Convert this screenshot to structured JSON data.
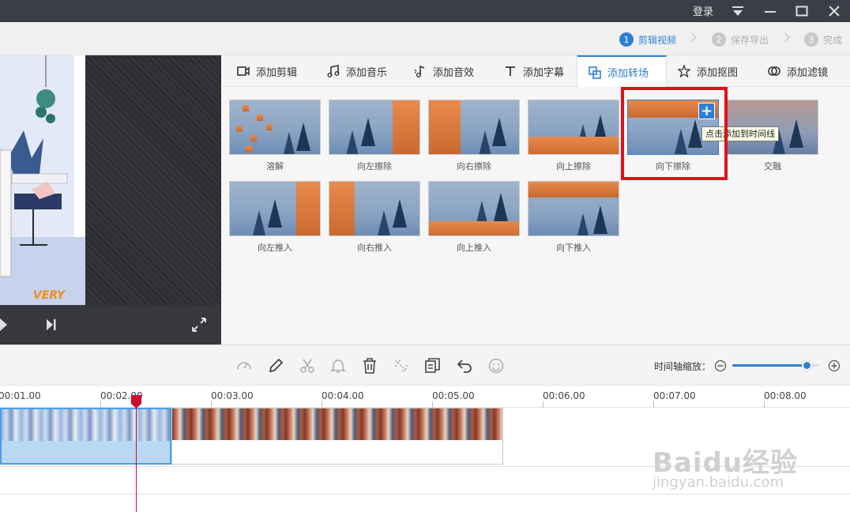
{
  "titlebar": {
    "login": "登录"
  },
  "steps": [
    {
      "num": "1",
      "label": "剪辑视频"
    },
    {
      "num": "2",
      "label": "保存导出"
    },
    {
      "num": "3",
      "label": "完成"
    }
  ],
  "tabs": [
    {
      "label": "添加剪辑",
      "icon": "video-icon"
    },
    {
      "label": "添加音乐",
      "icon": "music-icon"
    },
    {
      "label": "添加音效",
      "icon": "sound-effect-icon"
    },
    {
      "label": "添加字幕",
      "icon": "text-icon"
    },
    {
      "label": "添加转场",
      "icon": "transition-icon",
      "active": true
    },
    {
      "label": "添加抠图",
      "icon": "cutout-icon"
    },
    {
      "label": "添加滤镜",
      "icon": "filter-icon"
    }
  ],
  "transitions": [
    {
      "label": "溶解"
    },
    {
      "label": "向左擦除"
    },
    {
      "label": "向右擦除"
    },
    {
      "label": "向上擦除"
    },
    {
      "label": "向下擦除",
      "selected": true
    },
    {
      "label": "交融"
    },
    {
      "label": "向左推入"
    },
    {
      "label": "向右推入"
    },
    {
      "label": "向上推入"
    },
    {
      "label": "向下推入"
    }
  ],
  "tooltip": "点击添加到时间线",
  "preview": {
    "logo": "VERY"
  },
  "timeline": {
    "zoom_label": "时间轴缩放：",
    "zoom_level": 0.85,
    "ticks": [
      "00:01.00",
      "00:02.00",
      "00:03.00",
      "00:04.00",
      "00:05.00",
      "00:06.00",
      "00:07.00",
      "00:08.00"
    ]
  },
  "watermark": {
    "text": "Baidu经验",
    "sub": "jingyan.baidu.com"
  },
  "colors": {
    "accent": "#2f7fd6",
    "highlight": "#e0101a",
    "playhead": "#c8102e",
    "titlebar": "#3a3f47"
  }
}
